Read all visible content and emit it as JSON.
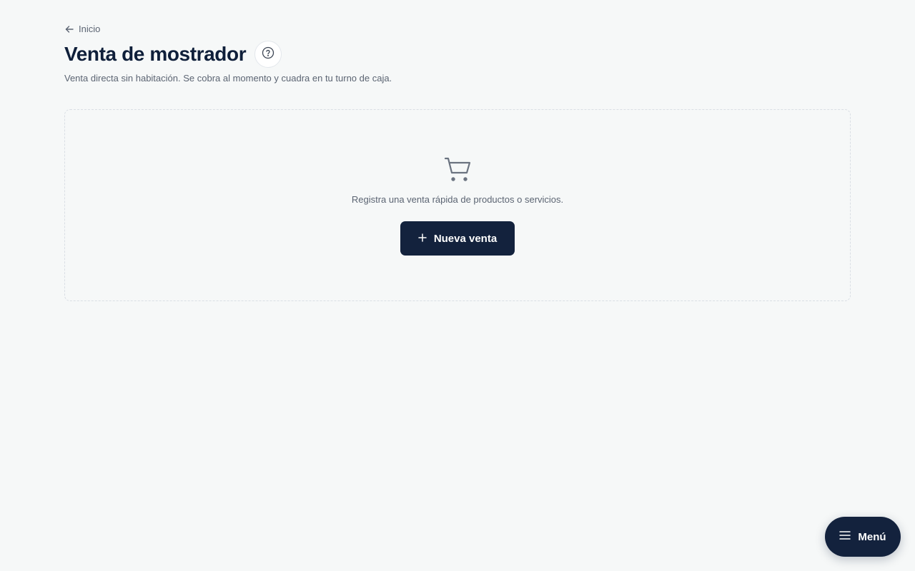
{
  "breadcrumb": {
    "back_label": "Inicio",
    "icon": "arrow-left-icon"
  },
  "header": {
    "title": "Venta de mostrador",
    "help_icon": "question-circle-icon",
    "subtitle": "Venta directa sin habitación. Se cobra al momento y cuadra en tu turno de caja."
  },
  "empty_state": {
    "icon": "shopping-cart-icon",
    "message": "Registra una venta rápida de productos o servicios.",
    "action_icon": "plus-icon",
    "action_label": "Nueva venta"
  },
  "menu": {
    "icon": "hamburger-icon",
    "label": "Menú"
  },
  "colors": {
    "background": "#f6f8f8",
    "primary": "#13223d",
    "text_muted": "#5b6472",
    "title": "#0f1f3a"
  }
}
